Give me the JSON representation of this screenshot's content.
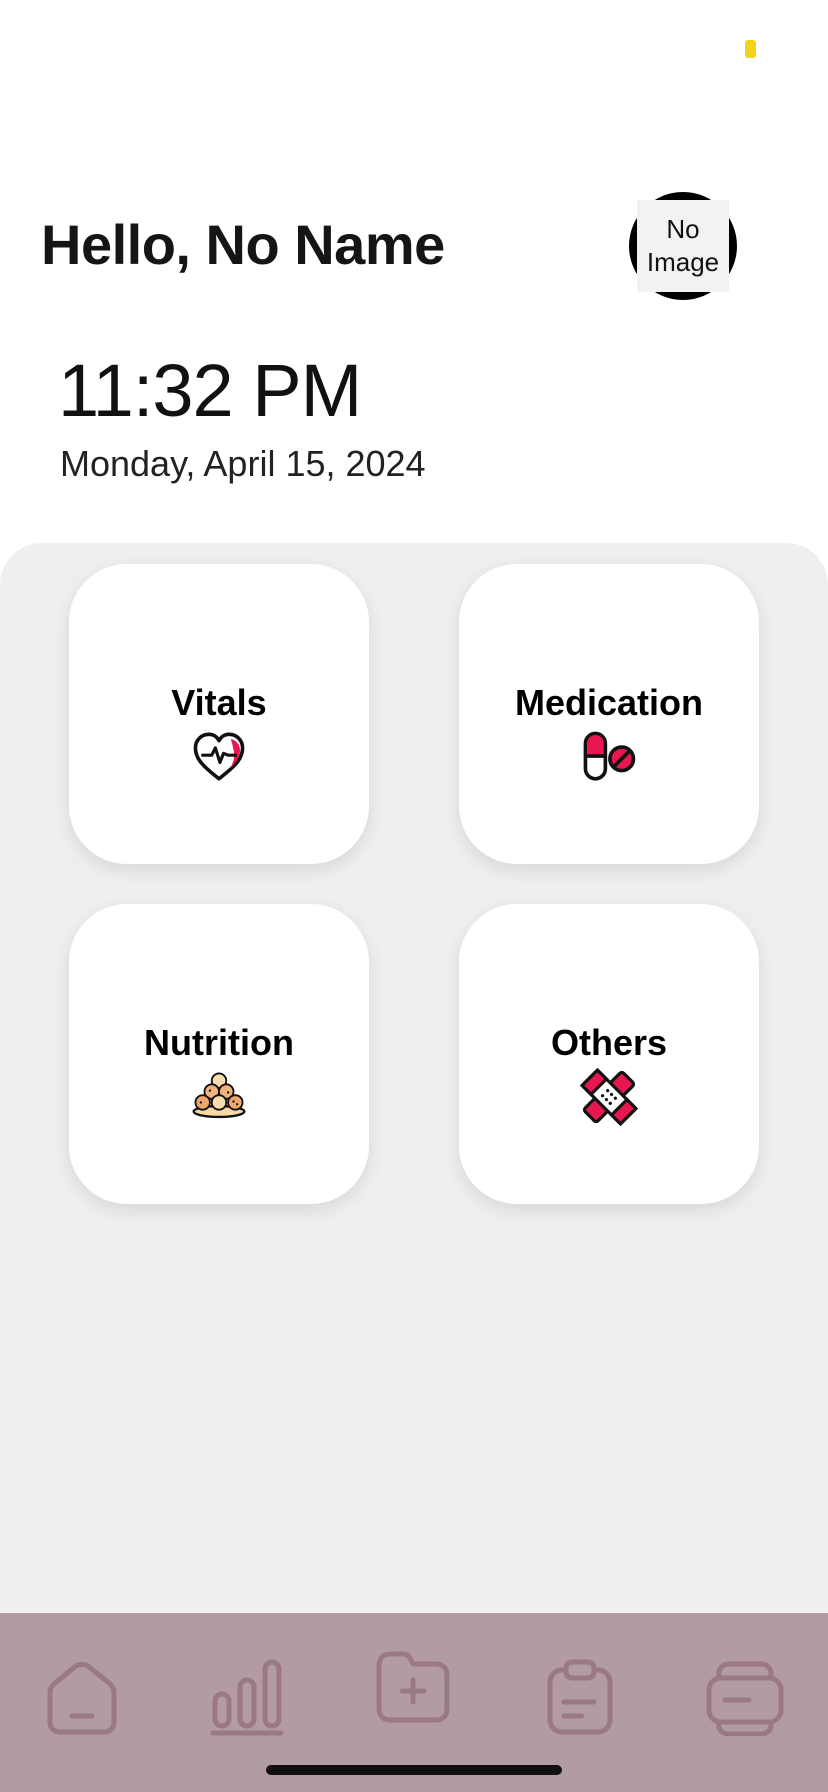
{
  "header": {
    "greeting": "Hello, No Name",
    "avatar_text_line1": "No",
    "avatar_text_line2": "Image"
  },
  "clock": {
    "time": "11:32 PM",
    "date": "Monday, April 15, 2024"
  },
  "cards": [
    {
      "label": "Vitals",
      "icon": "heart-pulse-icon"
    },
    {
      "label": "Medication",
      "icon": "pills-icon"
    },
    {
      "label": "Nutrition",
      "icon": "food-plate-icon"
    },
    {
      "label": "Others",
      "icon": "bandage-icon"
    }
  ],
  "tabbar": {
    "tabs": [
      {
        "icon": "home-icon"
      },
      {
        "icon": "bar-chart-icon"
      },
      {
        "icon": "folder-add-icon"
      },
      {
        "icon": "clipboard-icon"
      },
      {
        "icon": "card-icon"
      }
    ]
  },
  "colors": {
    "accent": "#e8174f",
    "tabbar_bg": "#b39ba2",
    "tab_icon": "#9a7884",
    "panel_bg": "#efefef",
    "status_dot": "#f2d21b"
  }
}
